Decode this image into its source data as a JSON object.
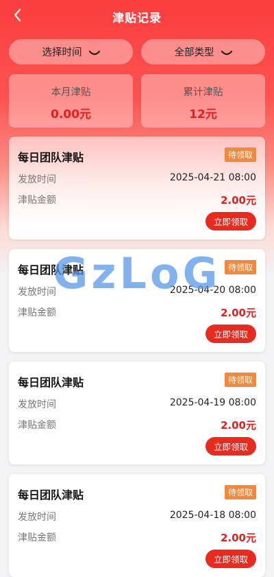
{
  "header": {
    "title": "津贴记录",
    "back_icon": "back-arrow-icon"
  },
  "filters": [
    {
      "label": "选择时间",
      "icon": "chevron-down-icon"
    },
    {
      "label": "全部类型",
      "icon": "chevron-down-icon"
    }
  ],
  "stats": [
    {
      "label": "本月津贴",
      "value": "0.00元"
    },
    {
      "label": "累计津贴",
      "value": "12元"
    }
  ],
  "records": [
    {
      "name": "每日团队津贴",
      "status": "待领取",
      "time_label": "发放时间",
      "time": "2025-04-21 08:00",
      "amount_label": "津贴金额",
      "amount": "2.00元",
      "action": "立即领取"
    },
    {
      "name": "每日团队津贴",
      "status": "待领取",
      "time_label": "发放时间",
      "time": "2025-04-20 08:00",
      "amount_label": "津贴金额",
      "amount": "2.00元",
      "action": "立即领取"
    },
    {
      "name": "每日团队津贴",
      "status": "待领取",
      "time_label": "发放时间",
      "time": "2025-04-19 08:00",
      "amount_label": "津贴金额",
      "amount": "2.00元",
      "action": "立即领取"
    },
    {
      "name": "每日团队津贴",
      "status": "待领取",
      "time_label": "发放时间",
      "time": "2025-04-18 08:00",
      "amount_label": "津贴金额",
      "amount": "2.00元",
      "action": "立即领取"
    }
  ],
  "watermark": "GzLoG",
  "colors": {
    "primary_red": "#fb3d3f",
    "amount_red": "#e41d1d",
    "button_red": "#e82a1f",
    "tag_orange": "#f0893d",
    "watermark_blue": "#5294e8"
  }
}
